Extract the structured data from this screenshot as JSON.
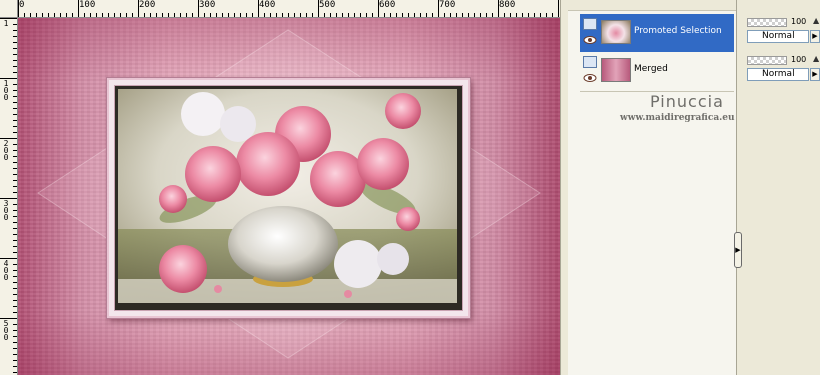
{
  "rulers": {
    "horizontal": [
      "0",
      "100",
      "200",
      "300",
      "400",
      "500",
      "600",
      "700",
      "800"
    ],
    "vertical": [
      "1",
      "100",
      "200",
      "300",
      "400",
      "500"
    ]
  },
  "layers": [
    {
      "name": "Promoted Selection",
      "selected": true
    },
    {
      "name": "Merged",
      "selected": false
    }
  ],
  "watermark": {
    "title": "Pinuccia",
    "url": "www.maidiregrafica.eu"
  },
  "layer_props": [
    {
      "opacity": "100",
      "blend_mode": "Normal"
    },
    {
      "opacity": "100",
      "blend_mode": "Normal"
    }
  ],
  "colors": {
    "selection": "#316ac5",
    "canvas_pink": "#d38ea7",
    "panel_bg": "#ece9d8"
  }
}
